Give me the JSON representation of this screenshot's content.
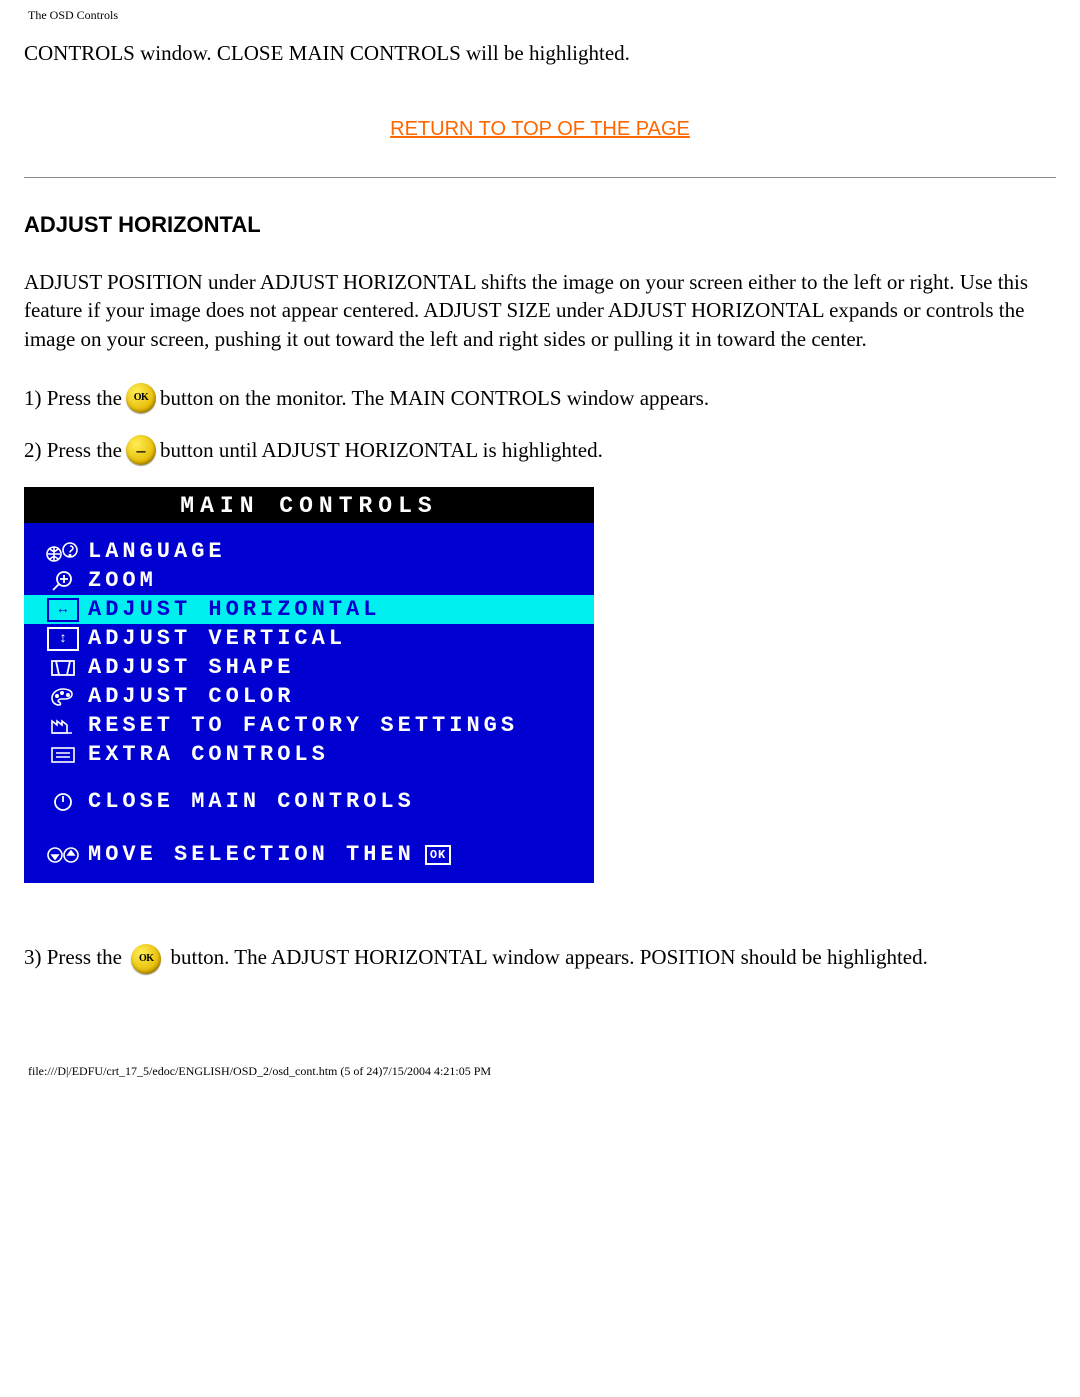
{
  "header_small": "The OSD Controls",
  "top_paragraph": "CONTROLS window. CLOSE MAIN CONTROLS will be highlighted.",
  "return_link": "RETURN TO TOP OF THE PAGE",
  "section_title": "ADJUST HORIZONTAL",
  "description": "ADJUST POSITION under ADJUST HORIZONTAL shifts the image on your screen either to the left or right. Use this feature if your image does not appear centered. ADJUST SIZE under ADJUST HORIZONTAL expands or controls the image on your screen, pushing it out toward the left and right sides or pulling it in toward the center.",
  "step1_pre": "1) Press the ",
  "step1_post": " button on the monitor. The MAIN CONTROLS window appears.",
  "step2_pre": "2) Press the ",
  "step2_post": " button until ADJUST HORIZONTAL is highlighted.",
  "step3_pre": "3) Press the ",
  "step3_post": " button. The ADJUST HORIZONTAL window appears. POSITION should be highlighted.",
  "osd": {
    "title": "MAIN CONTROLS",
    "items": [
      {
        "label": "LANGUAGE",
        "highlight": false
      },
      {
        "label": "ZOOM",
        "highlight": false
      },
      {
        "label": "ADJUST HORIZONTAL",
        "highlight": true
      },
      {
        "label": "ADJUST VERTICAL",
        "highlight": false
      },
      {
        "label": "ADJUST SHAPE",
        "highlight": false
      },
      {
        "label": "ADJUST COLOR",
        "highlight": false
      },
      {
        "label": "RESET TO FACTORY SETTINGS",
        "highlight": false
      },
      {
        "label": "EXTRA CONTROLS",
        "highlight": false
      }
    ],
    "close_label": "CLOSE MAIN CONTROLS",
    "footer_text": "MOVE SELECTION THEN",
    "footer_ok": "OK"
  },
  "page_footer": "file:///D|/EDFU/crt_17_5/edoc/ENGLISH/OSD_2/osd_cont.htm (5 of 24)7/15/2004 4:21:05 PM"
}
